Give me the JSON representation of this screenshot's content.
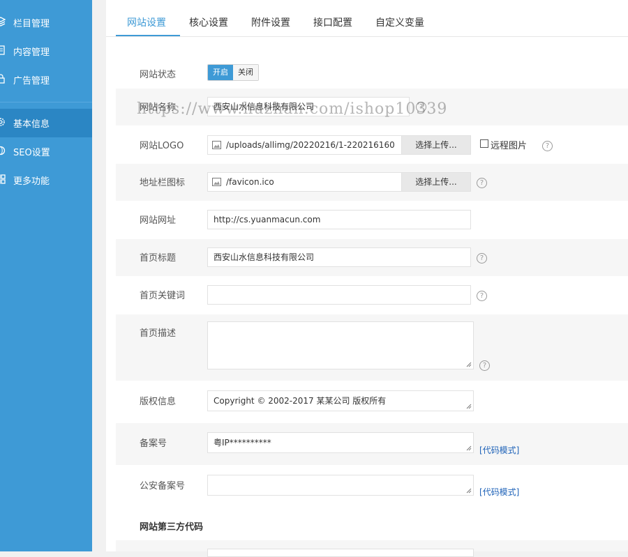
{
  "sidebar": {
    "items": [
      {
        "label": "栏目管理",
        "icon": "layers-icon"
      },
      {
        "label": "内容管理",
        "icon": "document-icon"
      },
      {
        "label": "广告管理",
        "icon": "lock-icon"
      },
      {
        "label": "基本信息",
        "icon": "gear-icon"
      },
      {
        "label": "SEO设置",
        "icon": "globe-icon"
      },
      {
        "label": "更多功能",
        "icon": "grid-icon"
      }
    ]
  },
  "tabs": [
    "网站设置",
    "核心设置",
    "附件设置",
    "接口配置",
    "自定义变量"
  ],
  "form": {
    "status": {
      "label": "网站状态",
      "on": "开启",
      "off": "关闭"
    },
    "site_name": {
      "label": "网站名称",
      "value": "西安山水信息科技有限公司"
    },
    "logo": {
      "label": "网站LOGO",
      "value": "/uploads/allimg/20220216/1-220216160",
      "button": "选择上传...",
      "remote_label": "远程图片"
    },
    "favicon": {
      "label": "地址栏图标",
      "value": "/favicon.ico",
      "button": "选择上传..."
    },
    "site_url": {
      "label": "网站网址",
      "value": "http://cs.yuanmacun.com"
    },
    "home_title": {
      "label": "首页标题",
      "value": "西安山水信息科技有限公司"
    },
    "keywords": {
      "label": "首页关键词",
      "value": ""
    },
    "description": {
      "label": "首页描述",
      "value": ""
    },
    "copyright": {
      "label": "版权信息",
      "value": "Copyright © 2002-2017 某某公司 版权所有"
    },
    "icp": {
      "label": "备案号",
      "value": "粤IP**********",
      "link": "[代码模式]"
    },
    "police": {
      "label": "公安备案号",
      "value": "",
      "link": "[代码模式]"
    },
    "third_party": {
      "label": "网站第三方代码"
    }
  },
  "watermark": "https://www.huzhan.com/ishop10339",
  "help_glyph": "?",
  "colors": {
    "sidebar": "#3e9ad6",
    "sidebar_active": "#2b86c4",
    "accent": "#3e9ad6",
    "link": "#1e62b8"
  }
}
